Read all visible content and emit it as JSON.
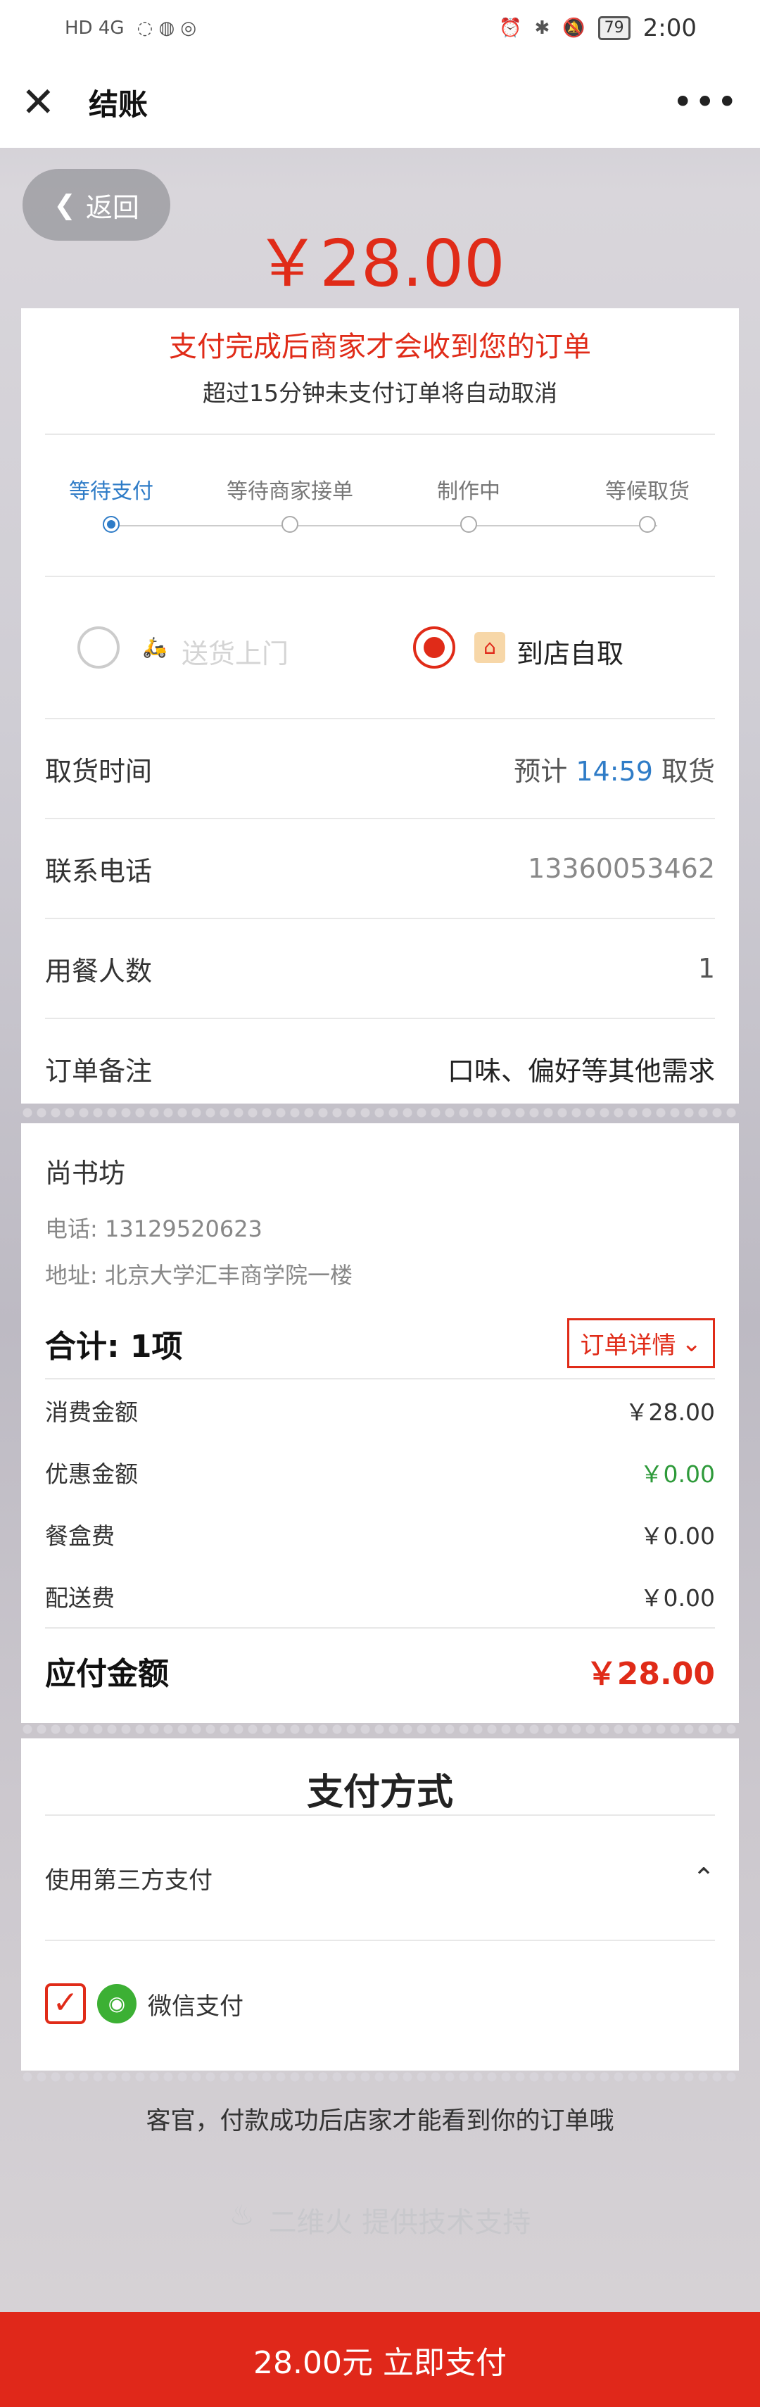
{
  "status_bar": {
    "left_icons": "HD 4G",
    "battery": "79",
    "time": "2:00"
  },
  "titlebar": {
    "title": "结账"
  },
  "back_label": "返回",
  "price": "￥28.00",
  "notice": {
    "main": "支付完成后商家才会收到您的订单",
    "sub": "超过15分钟未支付订单将自动取消"
  },
  "steps": [
    {
      "label": "等待支付",
      "active": true
    },
    {
      "label": "等待商家接单",
      "active": false
    },
    {
      "label": "制作中",
      "active": false
    },
    {
      "label": "等候取货",
      "active": false
    }
  ],
  "delivery": {
    "option1": "送货上门",
    "option2": "到店自取",
    "selected": "到店自取"
  },
  "fields": {
    "pickup_time": {
      "label": "取货时间",
      "prefix": "预计",
      "time": "14:59",
      "suffix": "取货"
    },
    "phone": {
      "label": "联系电话",
      "value": "13360053462"
    },
    "diners": {
      "label": "用餐人数",
      "value": "1"
    },
    "remark": {
      "label": "订单备注",
      "placeholder": "口味、偏好等其他需求"
    }
  },
  "shop": {
    "name": "尚书坊",
    "phone": "电话: 13129520623",
    "address": "地址: 北京大学汇丰商学院一楼"
  },
  "summary": {
    "count": "合计: 1项",
    "detail_label": "订单详情",
    "fees": [
      {
        "label": "消费金额",
        "value": "￥28.00"
      },
      {
        "label": "优惠金额",
        "value": "￥0.00"
      },
      {
        "label": "餐盒费",
        "value": "￥0.00"
      },
      {
        "label": "配送费",
        "value": "￥0.00"
      }
    ],
    "payable_label": "应付金额",
    "payable_value": "￥28.00"
  },
  "payment": {
    "title": "支付方式",
    "third_party": "使用第三方支付",
    "wechat": "微信支付"
  },
  "footer_note": "客官，付款成功后店家才能看到你的订单哦",
  "tech_support": "二维火 提供技术支持",
  "pay_button": "28.00元 立即支付",
  "colors": {
    "accent": "#e02b18",
    "blue": "#2f7cc7",
    "green": "#2e9a3a"
  }
}
